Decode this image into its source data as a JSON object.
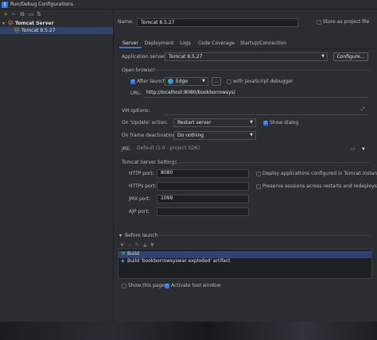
{
  "window": {
    "title": "Run/Debug Configurations"
  },
  "tree": {
    "group": "Tomcat Server",
    "item": "Tomcat 8.5.27"
  },
  "form": {
    "name_label": "Name:",
    "name_value": "Tomcat 8.5.27",
    "store_label": "Store as project file",
    "tabs": [
      "Server",
      "Deployment",
      "Logs",
      "Code Coverage",
      "Startup/Connection"
    ],
    "app_server_label": "Application server:",
    "app_server_value": "Tomcat 8.5.27",
    "configure_btn": "Configure...",
    "open_browser_label": "Open browser",
    "after_launch_label": "After launch",
    "browser_value": "Edge",
    "browse_btn": "...",
    "js_debugger_label": "with JavaScript debugger",
    "url_label": "URL:",
    "url_value": "http://localhost:8080/bookborrowsys/",
    "vm_label": "VM options:",
    "update_label": "On 'Update' action:",
    "update_value": "Restart server",
    "show_dialog_label": "Show dialog",
    "frame_label": "On frame deactivation:",
    "frame_value": "Do nothing",
    "jre_label": "JRE:",
    "jre_value": "Default (1.8 - project SDK)",
    "tomcat_settings_label": "Tomcat Server Settings",
    "http_port_label": "HTTP port:",
    "http_port_value": "8080",
    "https_port_label": "HTTPs port:",
    "https_port_value": "",
    "jmx_port_label": "JMX port:",
    "jmx_port_value": "1099",
    "ajp_port_label": "AJP port:",
    "ajp_port_value": "",
    "deploy_label": "Deploy applications configured in Tomcat instance",
    "preserve_label": "Preserve sessions across restarts and redeploys",
    "before_launch_label": "Before launch",
    "launch_items": [
      "Build",
      "Build 'bookborrowsyswar exploded' artifact"
    ],
    "show_page_label": "Show this page",
    "activate_label": "Activate tool window"
  },
  "colors": {
    "accent": "#3574f0",
    "background": "#2b2d30",
    "selection": "#2e436e"
  }
}
